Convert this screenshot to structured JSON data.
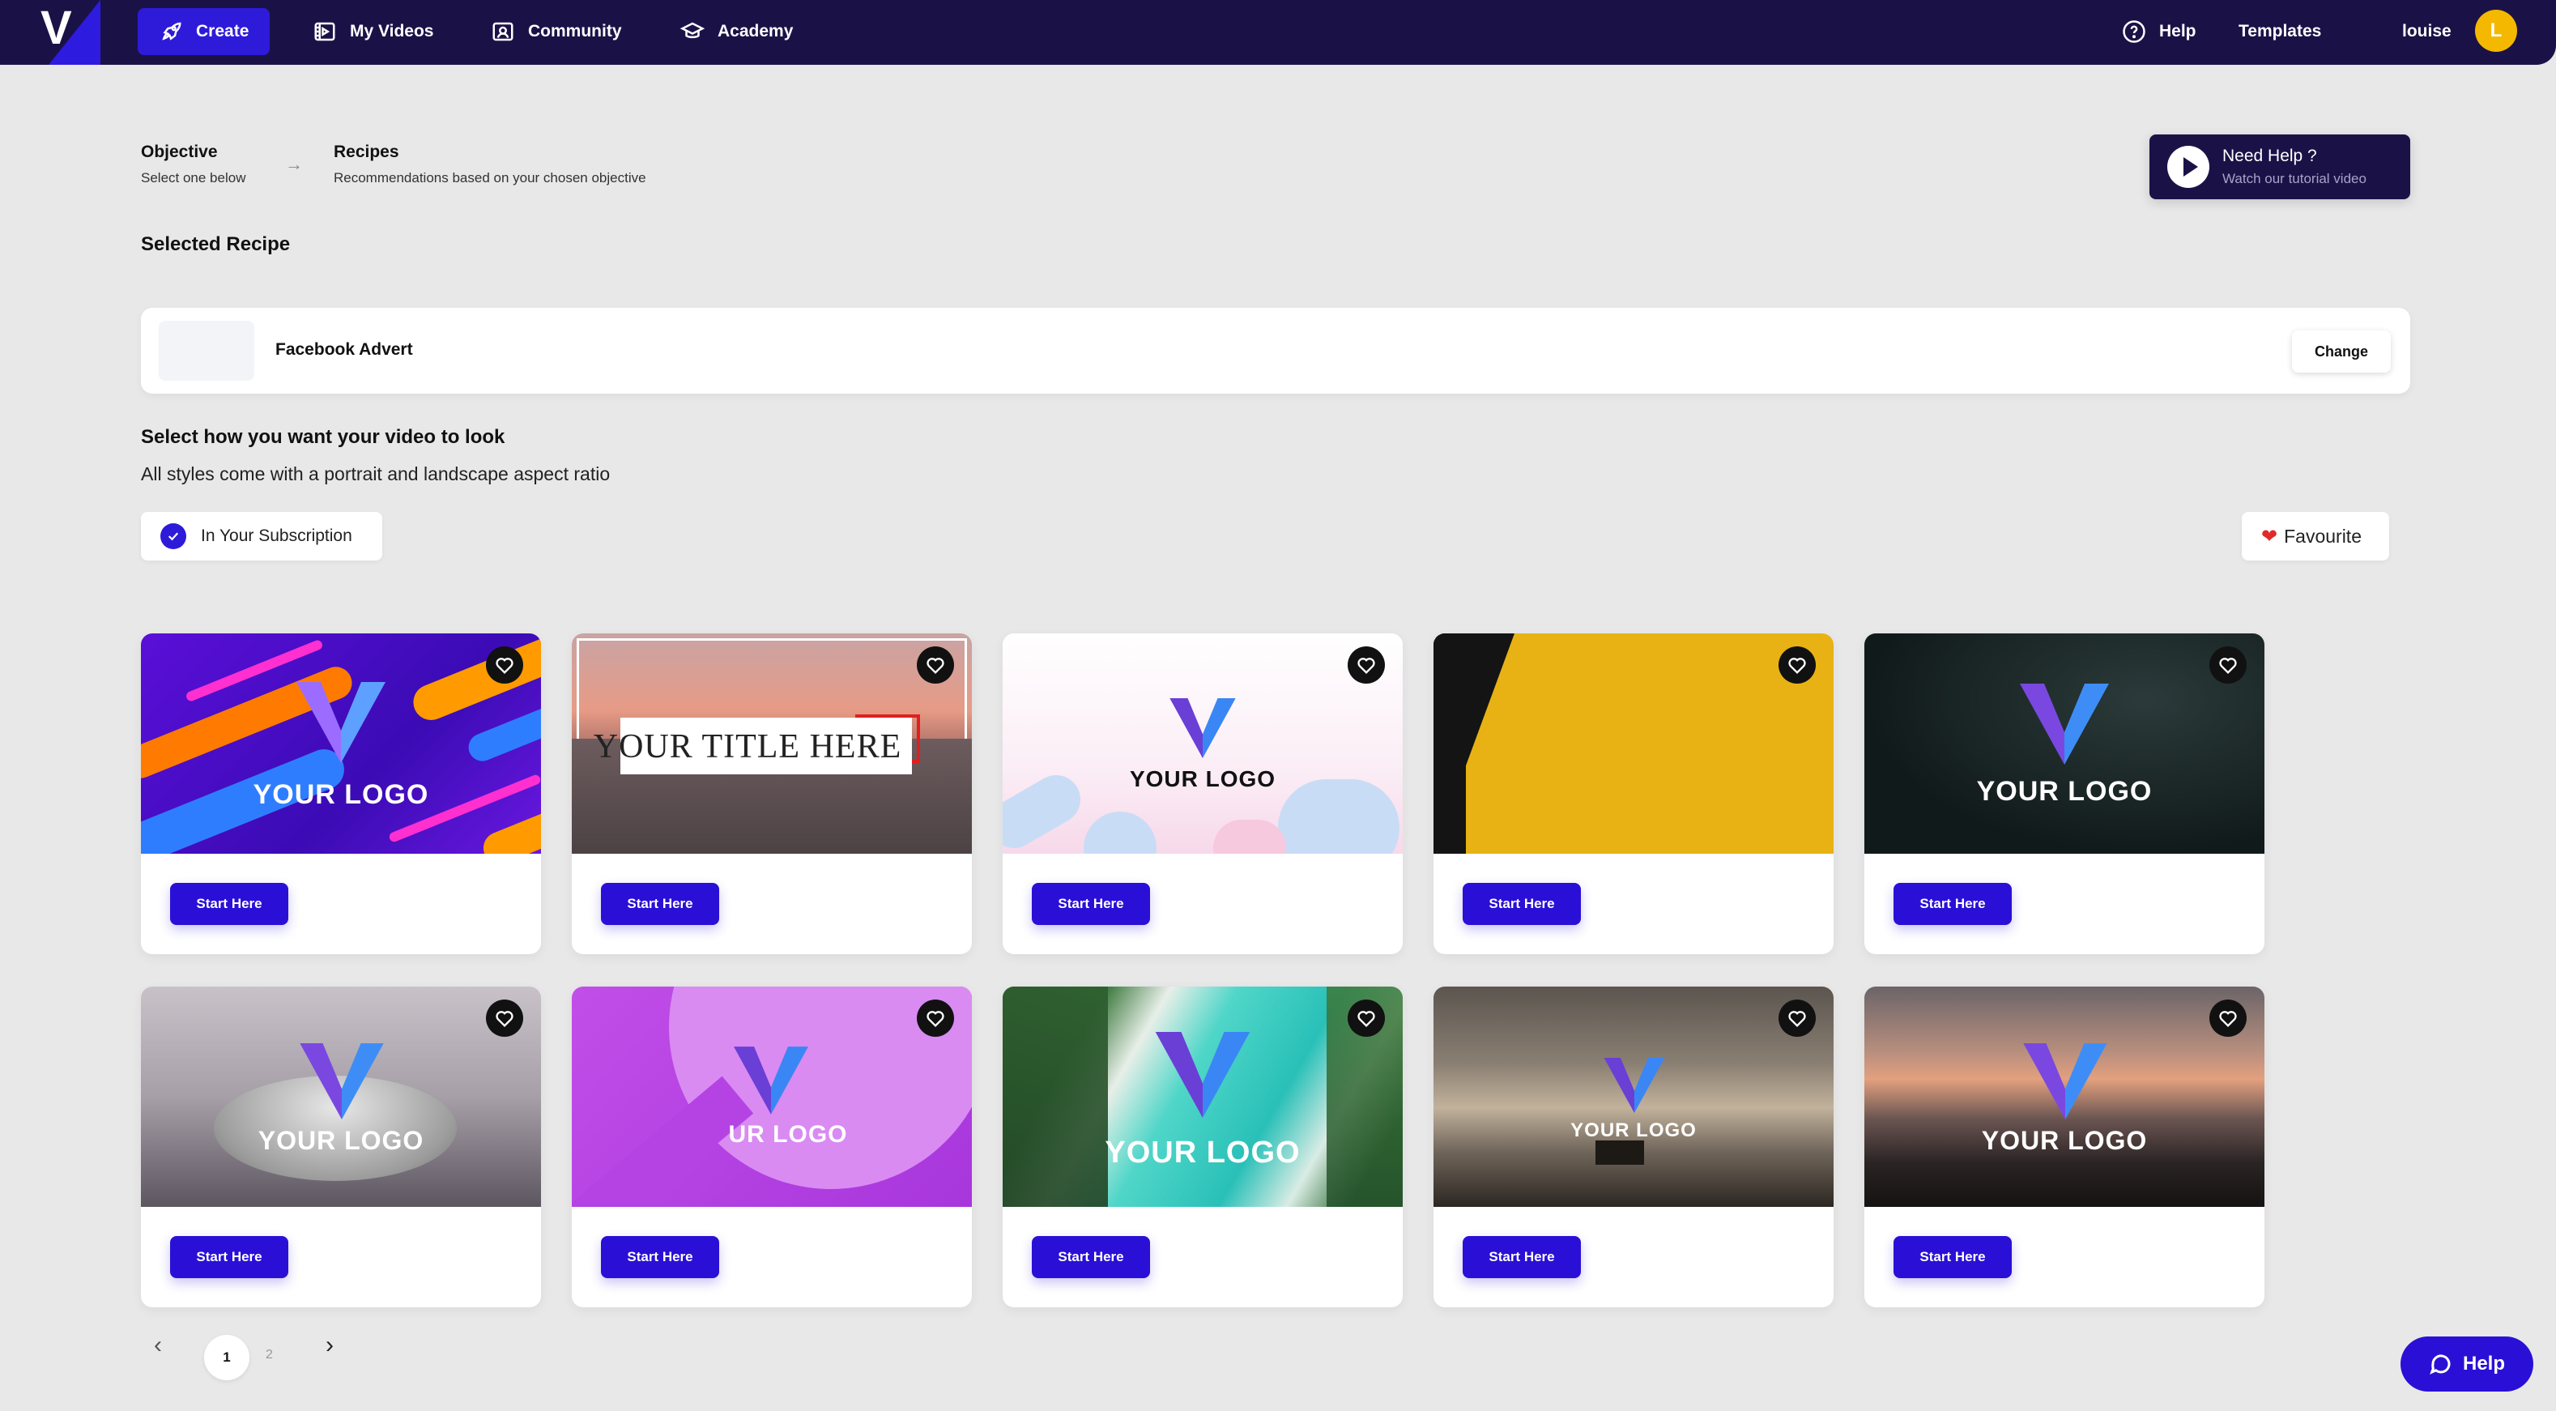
{
  "nav": {
    "brand": "V",
    "items": [
      {
        "label": "Create",
        "icon": "rocket-icon"
      },
      {
        "label": "My Videos",
        "icon": "film-icon"
      },
      {
        "label": "Community",
        "icon": "community-icon"
      },
      {
        "label": "Academy",
        "icon": "graduation-cap-icon"
      }
    ],
    "help": "Help",
    "templates": "Templates",
    "user": "louise",
    "avatar_initial": "L"
  },
  "steps": [
    {
      "title": "Objective",
      "subtitle": "Select one below"
    },
    {
      "title": "Recipes",
      "subtitle": "Recommendations based on your chosen objective"
    }
  ],
  "need_help": {
    "title": "Need Help ?",
    "subtitle": "Watch our tutorial video"
  },
  "selected_recipe": {
    "heading": "Selected Recipe",
    "name": "Facebook Advert",
    "change_label": "Change"
  },
  "look": {
    "title": "Select how you want your video to look",
    "subtitle": "All styles come with a portrait and landscape aspect ratio"
  },
  "filters": {
    "subscription": "In Your Subscription",
    "favourite": "Favourite"
  },
  "templates": [
    {
      "overlay": "YOUR LOGO",
      "style": "purple-stripes"
    },
    {
      "overlay": "YOUR TITLE HERE",
      "style": "sunset-sea"
    },
    {
      "overlay": "YOUR LOGO",
      "style": "pastel-shapes"
    },
    {
      "overlay": "",
      "style": "yellow-black"
    },
    {
      "overlay": "YOUR LOGO",
      "style": "dark-green"
    },
    {
      "overlay": "YOUR LOGO",
      "style": "speaker"
    },
    {
      "overlay": "UR LOGO",
      "style": "magenta-circle"
    },
    {
      "overlay": "YOUR LOGO",
      "style": "tropical-aerial"
    },
    {
      "overlay": "YOUR LOGO",
      "style": "misty-lake"
    },
    {
      "overlay": "YOUR LOGO",
      "style": "sunset-hills"
    }
  ],
  "start_label": "Start Here",
  "pagination": {
    "current": "1",
    "next": "2"
  },
  "help_button": "Help",
  "colors": {
    "nav_bg": "#1a1247",
    "accent": "#2a10d6",
    "avatar": "#f5b800"
  }
}
